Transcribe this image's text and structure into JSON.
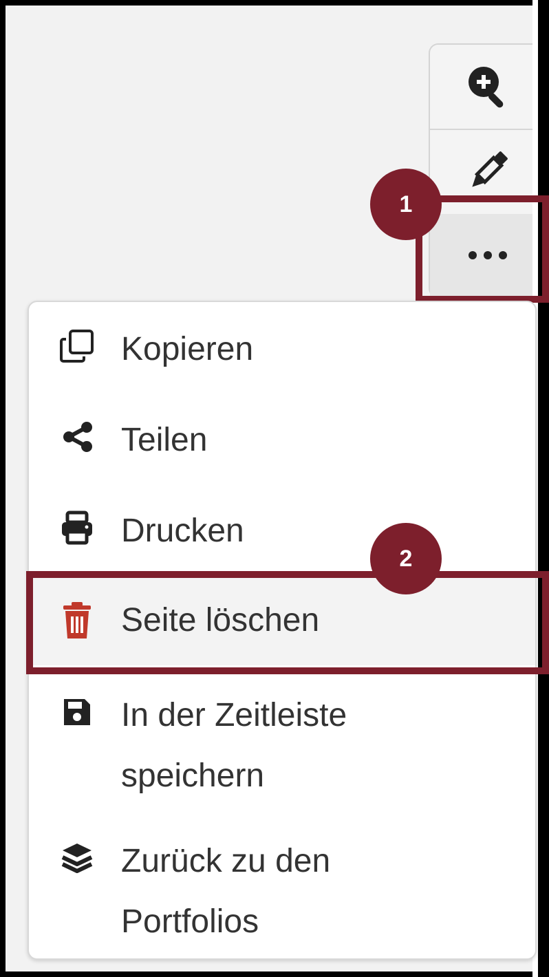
{
  "toolbar": {
    "buttons": [
      {
        "name": "zoom-in",
        "icon": "zoom-in-icon"
      },
      {
        "name": "edit",
        "icon": "pencil-icon"
      },
      {
        "name": "more",
        "icon": "ellipsis-icon"
      }
    ]
  },
  "callouts": {
    "step1": "1",
    "step2": "2"
  },
  "menu": {
    "items": [
      {
        "label": "Kopieren",
        "icon": "copy-icon"
      },
      {
        "label": "Teilen",
        "icon": "share-icon"
      },
      {
        "label": "Drucken",
        "icon": "print-icon"
      },
      {
        "label": "Seite löschen",
        "icon": "trash-icon"
      },
      {
        "label_line1": "In der Zeitleiste",
        "label_line2": "speichern",
        "icon": "save-icon"
      },
      {
        "label_line1": "Zurück zu den",
        "label_line2": "Portfolios",
        "icon": "layers-icon"
      }
    ]
  },
  "colors": {
    "highlight": "#7d1f2c",
    "danger_icon": "#c0392b",
    "icon_dark": "#222222",
    "text": "#333333"
  }
}
